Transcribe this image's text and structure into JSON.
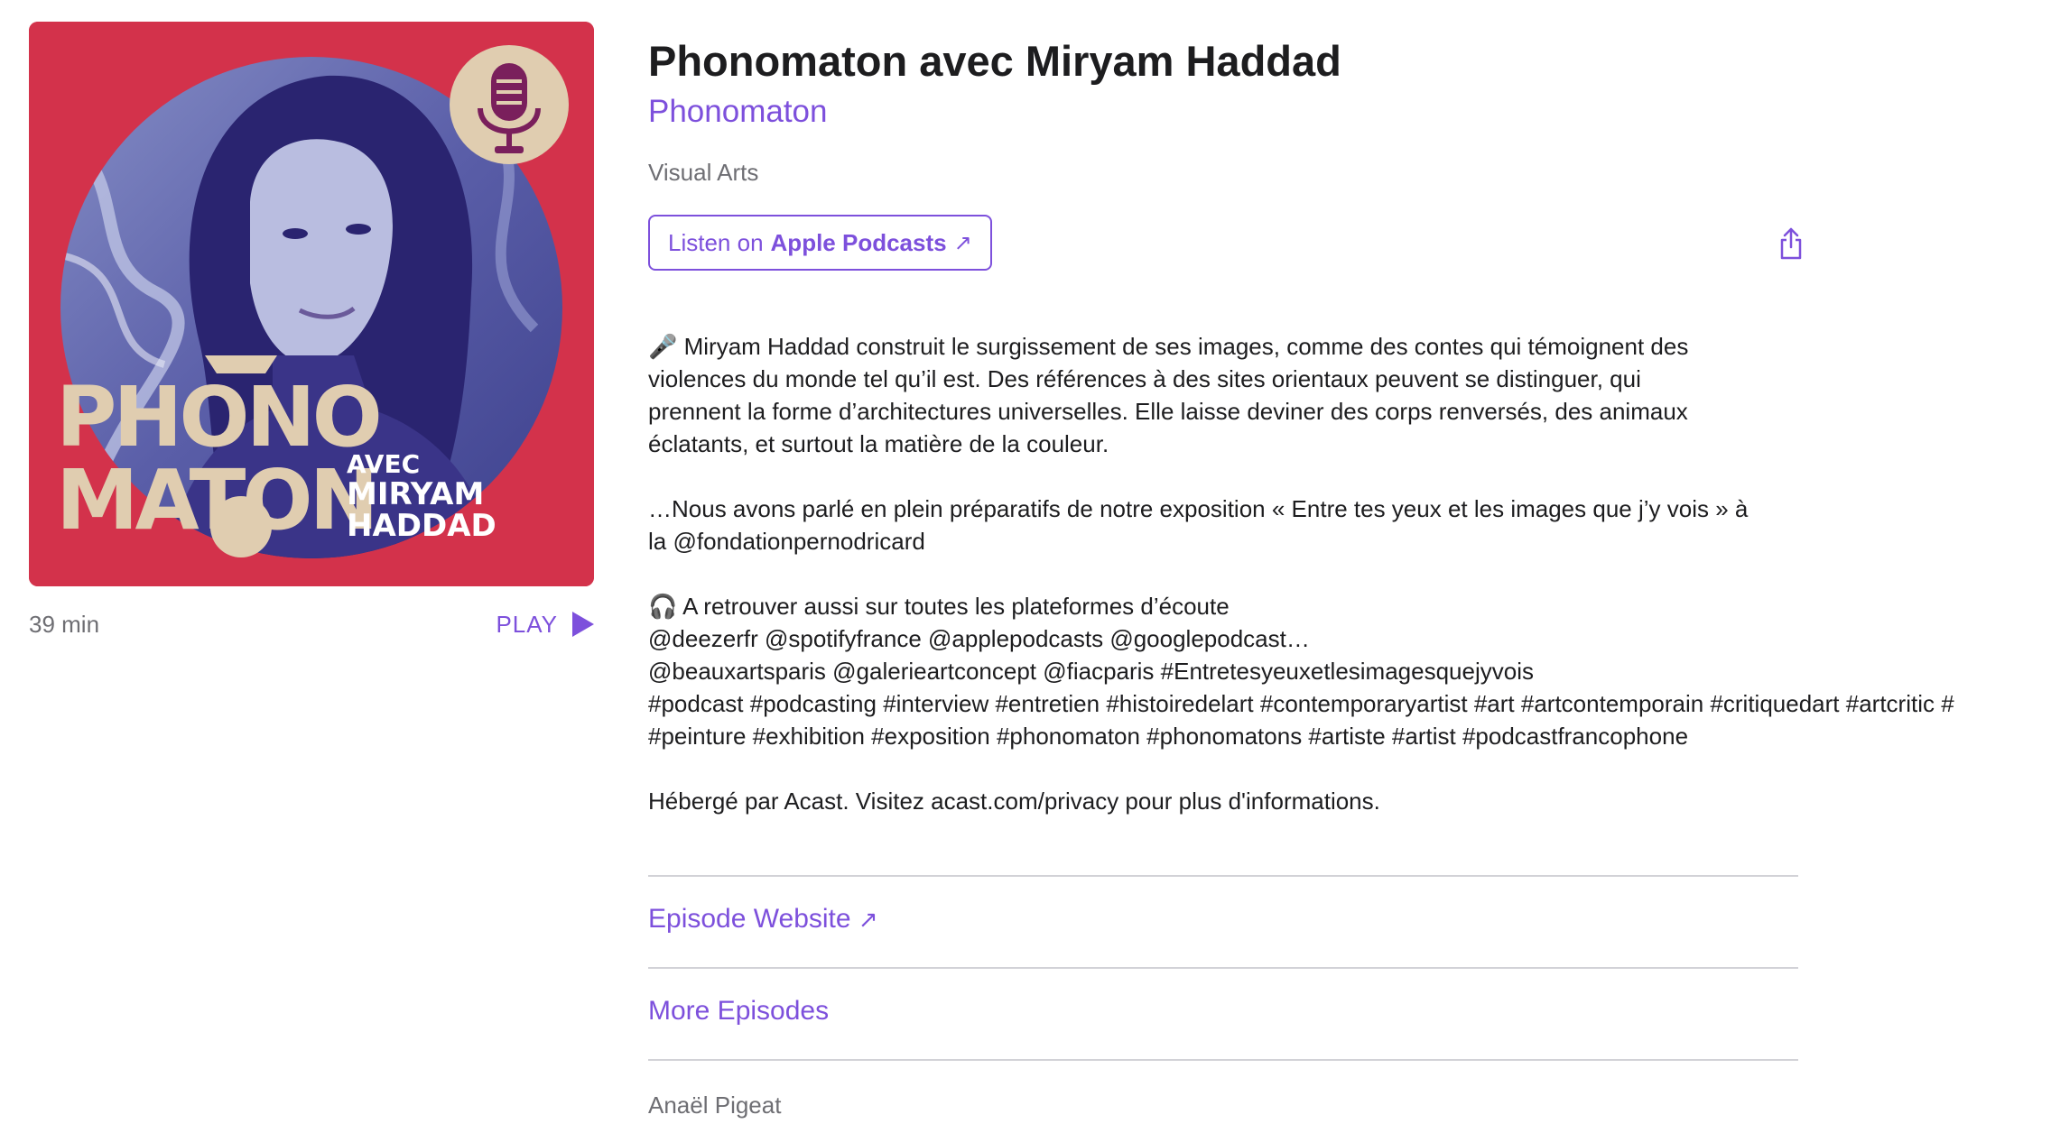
{
  "episode": {
    "title": "Phonomaton avec Miryam Haddad",
    "show_name": "Phonomaton",
    "category": "Visual Arts",
    "duration": "39 min",
    "play_label": "PLAY"
  },
  "artwork": {
    "word_line1": "PHONO",
    "word_line2": "MATON",
    "caption_line1": "AVEC",
    "caption_line2": "MIRYAM",
    "caption_line3": "HADDAD",
    "background_color": "#d3324b",
    "accent_color": "#e0cdb0",
    "icon": "microphone-icon"
  },
  "listen_button": {
    "prefix": "Listen on",
    "brand": "Apple Podcasts",
    "arrow": "↗"
  },
  "share_icon": "share-icon",
  "description": {
    "paragraph1": [
      "🎤 Miryam Haddad construit le surgissement de ses images, comme des contes qui témoignent des",
      "violences du monde tel qu’il est. Des références à des sites orientaux peuvent se distinguer, qui",
      "prennent la forme d’architectures universelles. Elle laisse deviner des corps renversés, des animaux",
      "éclatants, et surtout la matière de la couleur."
    ],
    "paragraph2": [
      "…Nous avons parlé en plein préparatifs de notre exposition « Entre tes yeux et les images que j’y vois » à",
      "la @fondationpernodricard"
    ],
    "paragraph3": [
      "🎧 A retrouver aussi sur toutes les plateformes d’écoute",
      "@deezerfr @spotifyfrance @applepodcasts @googlepodcast…",
      "@beauxartsparis @galerieartconcept @fiacparis #Entretesyeuxetlesimagesquejyvois",
      "#podcast #podcasting #interview #entretien #histoiredelart #contemporaryartist #art #artcontemporain #critiquedart #artcritic #",
      "#peinture #exhibition #exposition #phonomaton #phonomatons #artiste #artist #podcastfrancophone"
    ],
    "paragraph4": [
      "Hébergé par Acast. Visitez acast.com/privacy pour plus d'informations."
    ]
  },
  "links": {
    "episode_website": "Episode Website",
    "episode_website_arrow": "↗",
    "more_episodes": "More Episodes"
  },
  "host": "Anaël Pigeat",
  "colors": {
    "accent": "#7d50dc",
    "text": "#1d1d1f",
    "secondary_text": "#6e6e73",
    "divider": "#d2d2d7"
  }
}
